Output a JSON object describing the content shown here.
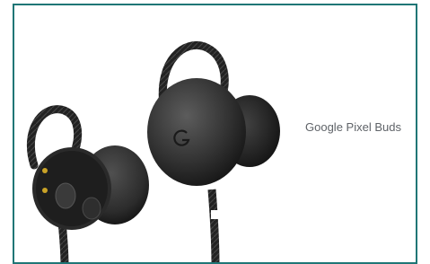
{
  "product": {
    "name": "Google Pixel Buds"
  },
  "image": {
    "subject": "earbuds-photo"
  },
  "colors": {
    "frame_border": "#1f7676",
    "bud_body": "#3a3a3a",
    "cord": "#222222",
    "label_text": "#5f6368"
  }
}
